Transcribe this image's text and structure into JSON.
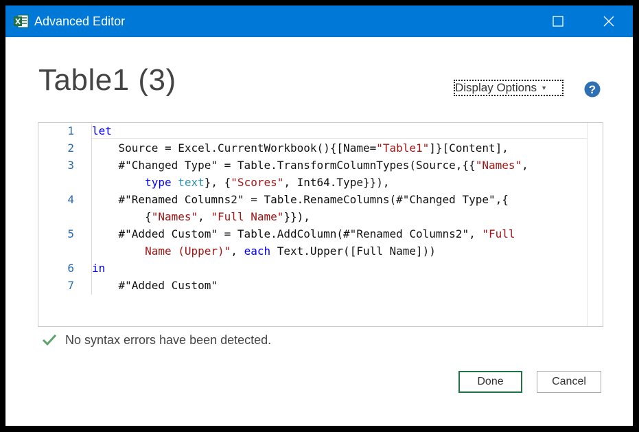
{
  "window": {
    "title": "Advanced Editor",
    "app_icon": "excel-icon"
  },
  "dialog": {
    "query_name": "Table1 (3)",
    "display_options_label": "Display Options",
    "help_icon": "help-icon"
  },
  "editor": {
    "lines": [
      {
        "number": "1",
        "tokens": [
          {
            "t": "let",
            "c": "kw"
          }
        ]
      },
      {
        "number": "2",
        "tokens": [
          {
            "t": "    Source = Excel.CurrentWorkbook(){[Name=",
            "c": ""
          },
          {
            "t": "\"Table1\"",
            "c": "str"
          },
          {
            "t": "]}[Content],",
            "c": ""
          }
        ]
      },
      {
        "number": "3",
        "tokens": [
          {
            "t": "    #\"Changed Type\" = Table.TransformColumnTypes(Source,{{",
            "c": ""
          },
          {
            "t": "\"Names\"",
            "c": "str"
          },
          {
            "t": ",",
            "c": ""
          }
        ]
      },
      {
        "number": "",
        "tokens": [
          {
            "t": "        ",
            "c": ""
          },
          {
            "t": "type",
            "c": "kw"
          },
          {
            "t": " ",
            "c": ""
          },
          {
            "t": "text",
            "c": "typ"
          },
          {
            "t": "}, {",
            "c": ""
          },
          {
            "t": "\"Scores\"",
            "c": "str"
          },
          {
            "t": ", Int64.Type}}),",
            "c": ""
          }
        ]
      },
      {
        "number": "4",
        "tokens": [
          {
            "t": "    #\"Renamed Columns2\" = Table.RenameColumns(#\"Changed Type\",{",
            "c": ""
          }
        ]
      },
      {
        "number": "",
        "tokens": [
          {
            "t": "        {",
            "c": ""
          },
          {
            "t": "\"Names\"",
            "c": "str"
          },
          {
            "t": ", ",
            "c": ""
          },
          {
            "t": "\"Full Name\"",
            "c": "str"
          },
          {
            "t": "}}),",
            "c": ""
          }
        ]
      },
      {
        "number": "5",
        "tokens": [
          {
            "t": "    #\"Added Custom\" = Table.AddColumn(#\"Renamed Columns2\", ",
            "c": ""
          },
          {
            "t": "\"Full",
            "c": "str"
          }
        ]
      },
      {
        "number": "",
        "tokens": [
          {
            "t": "        ",
            "c": ""
          },
          {
            "t": "Name (Upper)\"",
            "c": "str"
          },
          {
            "t": ", ",
            "c": ""
          },
          {
            "t": "each",
            "c": "kw"
          },
          {
            "t": " Text.Upper([Full Name]))",
            "c": ""
          }
        ]
      },
      {
        "number": "6",
        "tokens": [
          {
            "t": "in",
            "c": "kw"
          }
        ]
      },
      {
        "number": "7",
        "tokens": [
          {
            "t": "    #\"Added Custom\"",
            "c": ""
          }
        ]
      }
    ]
  },
  "status": {
    "icon": "check-icon",
    "text": "No syntax errors have been detected."
  },
  "buttons": {
    "done_label": "Done",
    "cancel_label": "Cancel"
  },
  "colors": {
    "titlebar": "#0078d7",
    "keyword": "#0000ff",
    "string": "#a31515",
    "type": "#2b91af",
    "line_number": "#2b6cb0",
    "done_border": "#217346",
    "check": "#5aa469"
  }
}
